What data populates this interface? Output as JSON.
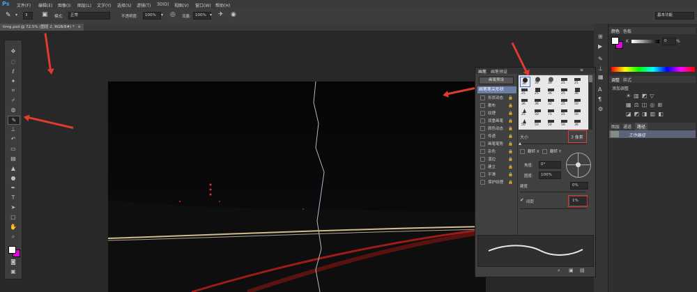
{
  "app": {
    "logo": "Ps"
  },
  "menu": [
    "文件(F)",
    "编辑(E)",
    "图像(I)",
    "图层(L)",
    "文字(Y)",
    "选择(S)",
    "滤镜(T)",
    "3D(D)",
    "视图(V)",
    "窗口(W)",
    "帮助(H)"
  ],
  "options_bar": {
    "brush_size": "3",
    "mode_label": "模式:",
    "mode_value": "正常",
    "opacity_label": "不透明度:",
    "opacity_value": "100%",
    "flow_label": "流量:",
    "flow_value": "100%",
    "workspace": "基本功能"
  },
  "document_tab": {
    "title": "timg.psd @ 72.5% (图层 2, RGB/8#) *"
  },
  "brush_panel": {
    "tabs": [
      "画笔",
      "画笔预设"
    ],
    "preset_button": "画笔预设",
    "active_option": "画笔笔尖形状",
    "options": [
      "形状动态",
      "散布",
      "纹理",
      "双重画笔",
      "颜色动态",
      "传递",
      "画笔笔势",
      "杂色",
      "湿边",
      "建立",
      "平滑",
      "保护纹理"
    ],
    "tip_sizes": [
      [
        "30",
        "30",
        "30",
        "25",
        "25"
      ],
      [
        "25",
        "25",
        "36",
        "25",
        "36"
      ],
      [
        "36",
        "36",
        "32",
        "25",
        "50"
      ],
      [
        "25",
        "50",
        "71",
        "25",
        "50"
      ],
      [
        "50",
        "50",
        "50",
        "50",
        "36"
      ]
    ],
    "size_label": "大小",
    "size_value": "3 像素",
    "flip_x": "翻转 X",
    "flip_y": "翻转 Y",
    "angle_label": "角度:",
    "angle_value": "0°",
    "roundness_label": "圆度:",
    "roundness_value": "100%",
    "hardness_label": "硬度",
    "hardness_value": "0%",
    "spacing_label": "间距",
    "spacing_value": "1%"
  },
  "color_panel": {
    "tabs": [
      "颜色",
      "色板"
    ],
    "k_label": "K",
    "k_value": "0",
    "k_unit": "%"
  },
  "adjust_panel": {
    "tabs": [
      "调整",
      "样式"
    ],
    "title": "添加调整"
  },
  "layers_panel": {
    "tabs": [
      "图层",
      "通道",
      "路径"
    ],
    "path_item": "工作路径"
  },
  "colors": {
    "accent_red": "#e23a2f",
    "foreground": "#ffffff",
    "background": "#e000e0"
  }
}
